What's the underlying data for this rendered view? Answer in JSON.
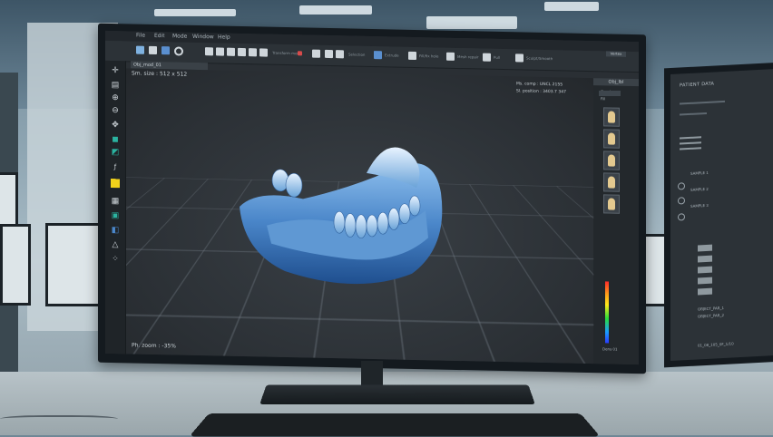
{
  "menu": [
    "File",
    "Edit",
    "Mode",
    "Window",
    "Help"
  ],
  "toolbar_labels": [
    "Transform mode",
    "Selection",
    "Extrude",
    "Fill/fix hole",
    "Mesh repair",
    "Pull",
    "Sculpt/Smooth"
  ],
  "doc_tab": "Obj_mod_01",
  "viewport": {
    "top_left": "Sm. size : 512 x 512",
    "top_right_1": "Ms. comp : UNCL 2155",
    "top_right_2": "Sl. position : 3403.7 347",
    "bottom_left": "Ph. zoom : -35%"
  },
  "right_panel": {
    "header": "Obj_lbl",
    "button": "Vertex",
    "toggle_1": "Overlay",
    "toggle_2": "Fill",
    "colorbar_label": "Dens 01"
  },
  "monitor2": {
    "title": "PATIENT DATA",
    "sample_labels": [
      "SAMPLE 1",
      "SAMPLE 2",
      "SAMPLE 3"
    ],
    "footer_1": "OBJECT_PAR_1",
    "footer_2": "OBJECT_PAR_2",
    "footer_3": "01_08_105_0F_1/10"
  },
  "colors": {
    "model": "#4a86c9",
    "viewport_bg": "#2b3035",
    "accent_yellow": "#f2d21b",
    "accent_teal": "#2bb3a0"
  }
}
